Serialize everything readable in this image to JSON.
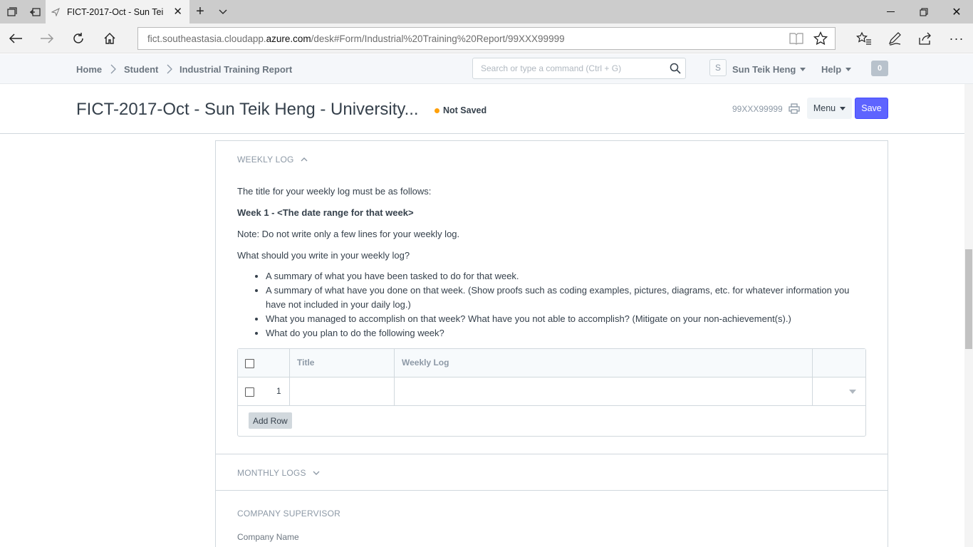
{
  "browser": {
    "tab_title": "FICT-2017-Oct - Sun Tei",
    "url_prefix": "fict.southeastasia.cloudapp.",
    "url_domain": "azure.com",
    "url_path": "/desk#Form/Industrial%20Training%20Report/99XXX99999"
  },
  "header": {
    "breadcrumbs": [
      "Home",
      "Student",
      "Industrial Training Report"
    ],
    "search_placeholder": "Search or type a command (Ctrl + G)",
    "avatar_initial": "S",
    "user_name": "Sun Teik Heng",
    "help_label": "Help",
    "notification_count": "0"
  },
  "page": {
    "title": "FICT-2017-Oct - Sun Teik Heng - University...",
    "status": "Not Saved",
    "doc_id": "99XXX99999",
    "menu_label": "Menu",
    "save_label": "Save"
  },
  "weekly_log": {
    "section_title": "WEEKLY LOG",
    "intro": "The title for your weekly log must be as follows:",
    "format": "Week 1 - <The date range for that week>",
    "note": "Note: Do not write only a few lines for your weekly log.",
    "question": "What should you write in your weekly log?",
    "bullets": [
      "A summary of what you have been tasked to do for that week.",
      "A summary of what have you done on that week. (Show proofs such as coding examples, pictures, diagrams, etc. for whatever information you have not included in your daily log.)",
      "What you managed to accomplish on that week? What have you not able to accomplish? (Mitigate on your non-achievement(s).)",
      "What do you plan to do the following week?"
    ],
    "grid": {
      "columns": [
        "Title",
        "Weekly Log"
      ],
      "rows": [
        {
          "idx": "1",
          "title": "",
          "log": ""
        }
      ],
      "add_row_label": "Add Row"
    }
  },
  "monthly_logs": {
    "section_title": "MONTHLY LOGS"
  },
  "company_supervisor": {
    "section_title": "COMPANY SUPERVISOR",
    "company_name_label": "Company Name"
  }
}
